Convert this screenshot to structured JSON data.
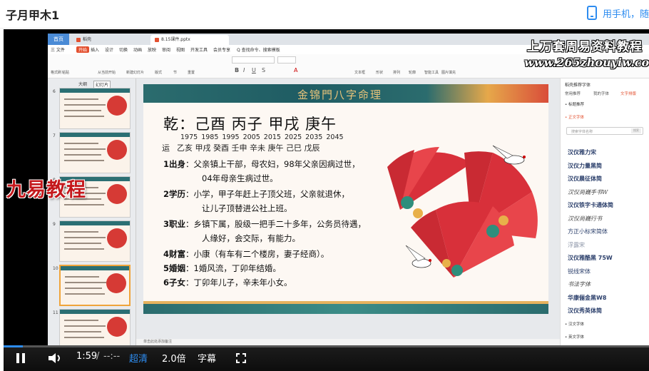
{
  "header": {
    "title": "子月甲木1",
    "phone_link": "用手机，随"
  },
  "app": {
    "home_tab": "首页",
    "doc_tab_1": "稻壳",
    "doc_tab_2": "8.15课件.pptx",
    "menu": [
      "三 文件",
      "开始",
      "插入",
      "设计",
      "切换",
      "动画",
      "放映",
      "审阅",
      "视图",
      "开发工具",
      "会员专享",
      "Q 查找命令、搜索模板"
    ],
    "menu_active_index": 1,
    "ribbon_labels": [
      "格式刷",
      "粘贴",
      "从当前开始",
      "新建幻灯片",
      "版式",
      "节",
      "重置",
      "文本框",
      "形状",
      "排列",
      "轮廓",
      "智能工具",
      "图片填充"
    ],
    "sidebar_tabs": [
      "大纲",
      "幻灯片"
    ],
    "slide_numbers": [
      "6",
      "7",
      "8",
      "9",
      "10",
      "11"
    ],
    "status_text": "单击此处添加备注"
  },
  "slide": {
    "header_title": "金锦門八字命理",
    "qian": "乾：己酉 丙子 甲戌 庚午",
    "years": "1975 1985 1995 2005 2015 2025 2035 2045",
    "yun_label": "运",
    "yun": "乙亥 甲戌 癸酉 壬申 辛未 庚午 己巳 戊辰",
    "items": [
      {
        "label": "1出身",
        "text": "：父亲镇上干部，母农妇，98年父亲因病过世，",
        "cont": "04年母亲生病过世。"
      },
      {
        "label": "2学历",
        "text": "：小学，甲子年赶上子顶父班，父亲就退休，",
        "cont": "让儿子顶替进公社上班。"
      },
      {
        "label": "3职业",
        "text": "：乡镇下属，股级一把手二十多年，公务员待遇，",
        "cont": "人缘好，会交际，有能力。"
      },
      {
        "label": "4财富",
        "text": "：小康（有车有二个楼房，妻子经商）。",
        "cont": ""
      },
      {
        "label": "5婚姻",
        "text": "：1婚风流，丁卯年结婚。",
        "cont": ""
      },
      {
        "label": "6子女",
        "text": "：丁卯年儿子，辛未年小女。",
        "cont": ""
      }
    ]
  },
  "right_panel": {
    "title": "稻壳推荐字体",
    "tabs": [
      "常用推荐",
      "我的字体",
      "文字排版"
    ],
    "section_1": "• 标题推荐",
    "section_2": "• 正文字体",
    "search_placeholder": "搜索字体名称",
    "search_button": "搜索",
    "fonts": [
      "汉仪雅力宋",
      "汉仪力量黑简",
      "汉仪晨征体简",
      "汉仪尚巍手书W",
      "汉仪铁字卡通体简",
      "汉仪尚巍行书",
      "方正小标宋简体",
      "浮露宋",
      "汉仪雅酷黑 75W",
      "锐线宋体",
      "书法字体",
      "华康俪金黑W8",
      "汉仪秀英体简"
    ],
    "section_3": "• 汉文字体",
    "section_4": "• 英文字体"
  },
  "watermarks": {
    "top": "上万套周易资料教程",
    "url": "www.265zhouyiw.com",
    "left": "九易教程"
  },
  "player": {
    "time": "1:59",
    "separator": "/",
    "duration": "--:--",
    "quality": "超清",
    "speed": "2.0倍",
    "subtitle": "字幕",
    "progress": 0.03
  },
  "colors": {
    "accent_red": "#e3502f",
    "link_blue": "#2d8cf0",
    "slide_band": "#2b6c6e"
  }
}
